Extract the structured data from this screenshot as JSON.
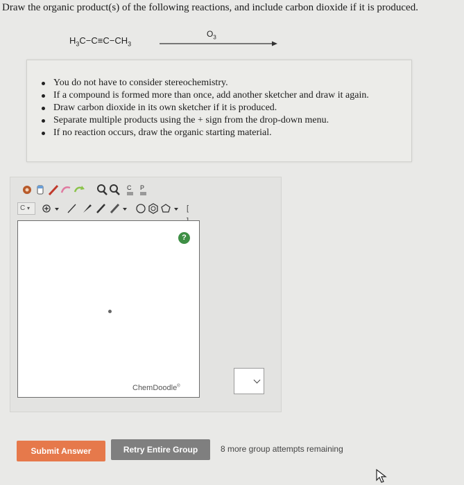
{
  "question": {
    "prompt": "Draw the organic product(s) of the following reactions, and include carbon dioxide if it is produced."
  },
  "reaction": {
    "reactant": {
      "a": "H",
      "a_sub": "3",
      "b": "C−C≡C−CH",
      "b_sub": "3"
    },
    "reagent": {
      "main": "O",
      "sub": "3"
    }
  },
  "instructions": [
    "You do not have to consider stereochemistry.",
    "If a compound is formed more than once, add another sketcher and draw it again.",
    "Draw carbon dioxide in its own sketcher if it is produced.",
    "Separate multiple products using the + sign from the drop-down menu.",
    "If no reaction occurs, draw the organic starting material."
  ],
  "sketcher": {
    "toolbar_row1": [
      "open-icon",
      "eraser-icon",
      "pencil-icon",
      "lasso-icon",
      "undo-icon",
      "zoom-in-icon",
      "zoom-out-icon",
      "copy-icon",
      "paste-icon"
    ],
    "toolbar_row2": [
      "atom-selector",
      "charge-selector",
      "single-bond-tool",
      "wedge-bond-tool",
      "bold-bond-tool",
      "bond-dropdown",
      "cyclopentane-tool",
      "benzene-tool",
      "cyclohexane-tool",
      "ring-dropdown",
      "bracket-tool"
    ],
    "atom_label": "C",
    "bracket_label": "[ ]",
    "help_label": "?",
    "brand": "ChemDoodle",
    "brand_mark": "®"
  },
  "operator_select": {
    "value": ""
  },
  "buttons": {
    "submit": "Submit Answer",
    "retry": "Retry Entire Group"
  },
  "attempts_text": "8 more group attempts remaining",
  "colors": {
    "submit": "#e6794b",
    "retry": "#7f7f7f",
    "help": "#3e8f45"
  }
}
